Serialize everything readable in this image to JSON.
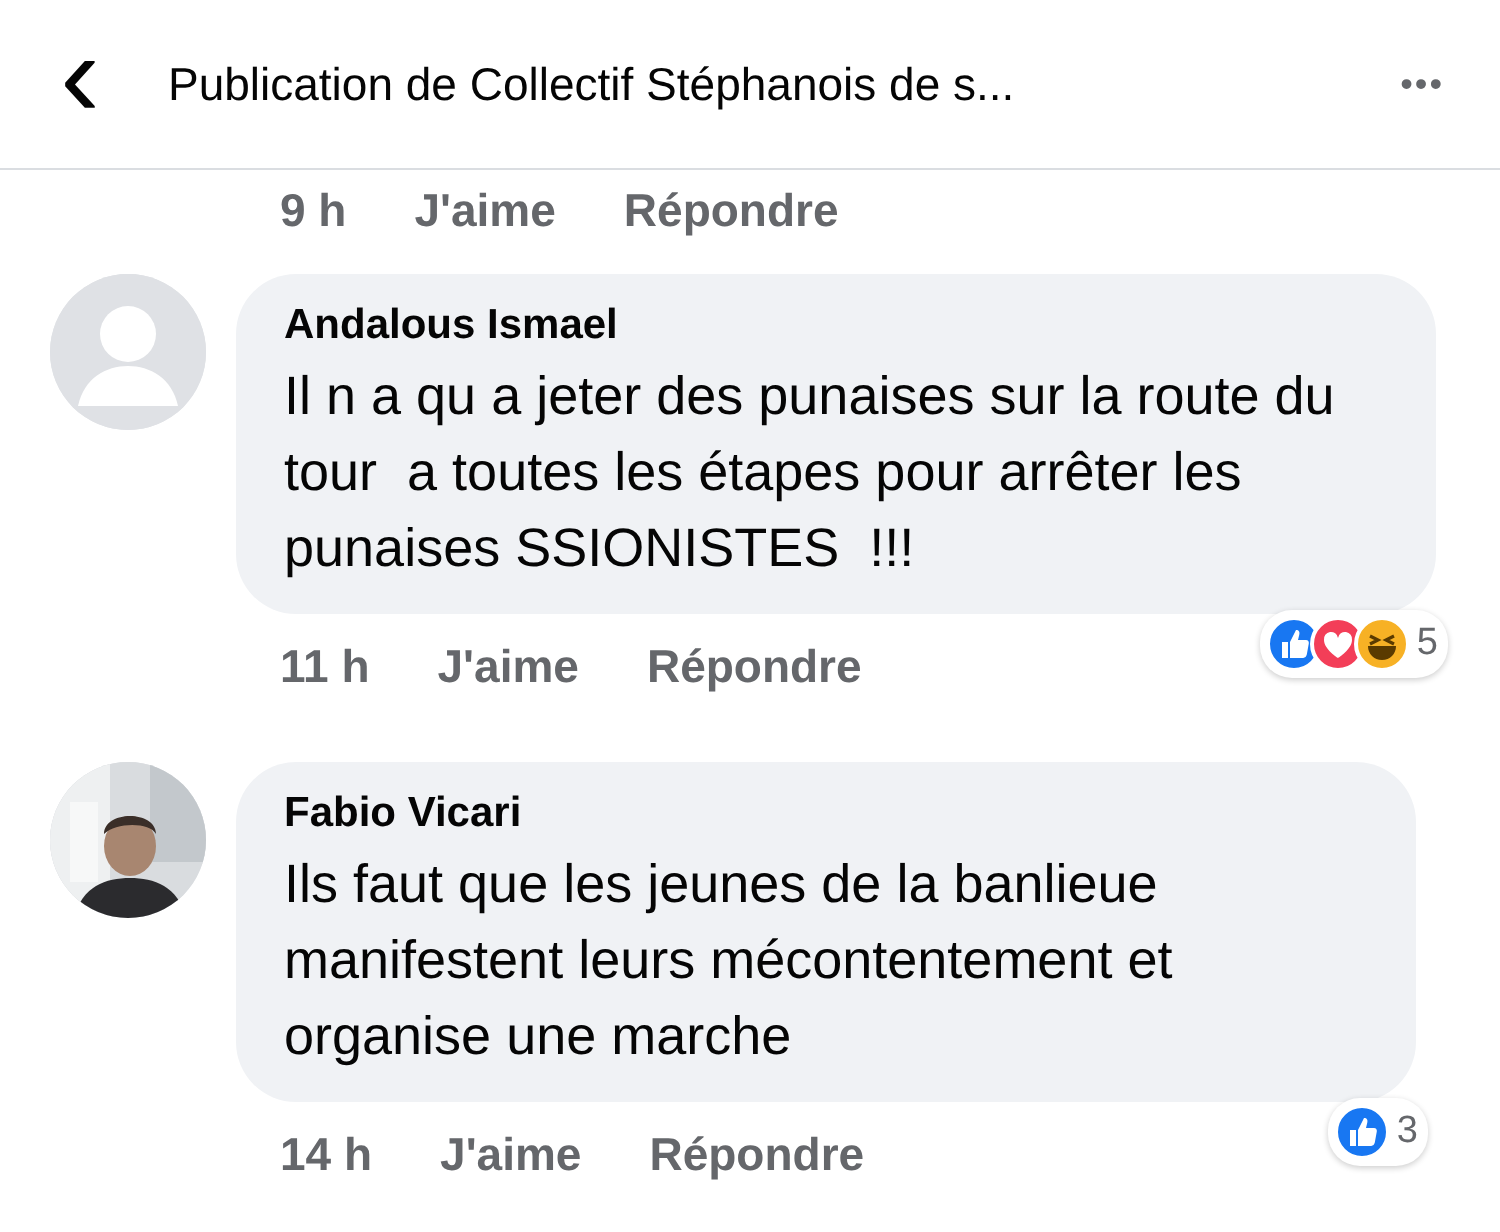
{
  "header": {
    "back": "‹",
    "title": "Publication de Collectif Stéphanois de s...",
    "more": "•••"
  },
  "cut_meta": {
    "time": "9 h",
    "like": "J'aime",
    "reply": "Répondre"
  },
  "comments": [
    {
      "author": "Andalous Ismael",
      "avatar": {
        "kind": "placeholder"
      },
      "text": "Il n a qu a jeter des punaises sur la route du tour  a toutes les étapes pour arrêter les punaises SSIONISTES  !!!",
      "time": "11 h",
      "like": "J'aime",
      "reply": "Répondre",
      "reactions": [
        {
          "kind": "like"
        },
        {
          "kind": "love"
        },
        {
          "kind": "haha"
        }
      ],
      "count": "5"
    },
    {
      "author": "Fabio Vicari",
      "avatar": {
        "kind": "picture"
      },
      "text": "Ils faut que les jeunes de la banlieue manifestent leurs mécontentement et organise une marche",
      "time": "14 h",
      "like": "J'aime",
      "reply": "Répondre",
      "reactions": [
        {
          "kind": "like"
        }
      ],
      "count": "3"
    }
  ]
}
